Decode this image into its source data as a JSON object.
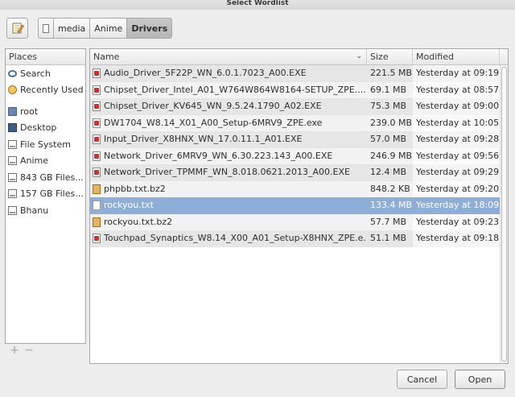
{
  "window": {
    "title": "Select Wordlist"
  },
  "pathbar": {
    "edit_icon": "pencil-notepad-icon",
    "root_icon": "square-icon",
    "crumbs": [
      "media",
      "Anime",
      "Drivers"
    ]
  },
  "places": {
    "header": "Places",
    "items": [
      {
        "label": "Search",
        "icon": "search-icon"
      },
      {
        "label": "Recently Used",
        "icon": "recent-icon"
      },
      {
        "label": "root",
        "icon": "home-folder-icon"
      },
      {
        "label": "Desktop",
        "icon": "desktop-icon"
      },
      {
        "label": "File System",
        "icon": "drive-icon"
      },
      {
        "label": "Anime",
        "icon": "drive-icon"
      },
      {
        "label": "843 GB Files...",
        "icon": "drive-icon"
      },
      {
        "label": "157 GB Files...",
        "icon": "drive-icon"
      },
      {
        "label": "Bhanu",
        "icon": "drive-icon"
      }
    ],
    "add_symbol": "+",
    "remove_symbol": "−"
  },
  "files": {
    "columns": {
      "name": "Name",
      "size": "Size",
      "modified": "Modified",
      "sort_indicator": "⌄"
    },
    "rows": [
      {
        "name": "Audio_Driver_5F22P_WN_6.0.1.7023_A00.EXE",
        "size": "221.5 MB",
        "modified": "Yesterday at 09:19",
        "icon": "exe-icon"
      },
      {
        "name": "Chipset_Driver_Intel_A01_W764W864W8164-SETUP_ZPE....",
        "size": "69.1 MB",
        "modified": "Yesterday at 08:57",
        "icon": "exe-icon"
      },
      {
        "name": "Chipset_Driver_KV645_WN_9.5.24.1790_A02.EXE",
        "size": "75.3 MB",
        "modified": "Yesterday at 09:00",
        "icon": "exe-icon"
      },
      {
        "name": "DW1704_W8.14_X01_A00_Setup-6MRV9_ZPE.exe",
        "size": "239.0 MB",
        "modified": "Yesterday at 10:05",
        "icon": "exe-icon"
      },
      {
        "name": "Input_Driver_X8HNX_WN_17.0.11.1_A01.EXE",
        "size": "57.0 MB",
        "modified": "Yesterday at 09:28",
        "icon": "exe-icon"
      },
      {
        "name": "Network_Driver_6MRV9_WN_6.30.223.143_A00.EXE",
        "size": "246.9 MB",
        "modified": "Yesterday at 09:56",
        "icon": "exe-icon"
      },
      {
        "name": "Network_Driver_TPMMF_WN_8.018.0621.2013_A00.EXE",
        "size": "12.4 MB",
        "modified": "Yesterday at 09:29",
        "icon": "exe-icon"
      },
      {
        "name": "phpbb.txt.bz2",
        "size": "848.2 KB",
        "modified": "Yesterday at 09:20",
        "icon": "archive-icon"
      },
      {
        "name": "rockyou.txt",
        "size": "133.4 MB",
        "modified": "Yesterday at 18:09",
        "icon": "text-file-icon",
        "selected": true
      },
      {
        "name": "rockyou.txt.bz2",
        "size": "57.7 MB",
        "modified": "Yesterday at 09:23",
        "icon": "archive-icon"
      },
      {
        "name": "Touchpad_Synaptics_W8.14_X00_A01_Setup-X8HNX_ZPE.e...",
        "size": "51.1 MB",
        "modified": "Yesterday at 09:18",
        "icon": "exe-icon"
      }
    ]
  },
  "actions": {
    "cancel": "Cancel",
    "open": "Open"
  },
  "colors": {
    "selection": "#8eaed8",
    "background": "#ededed",
    "border": "#a8a8a8"
  }
}
